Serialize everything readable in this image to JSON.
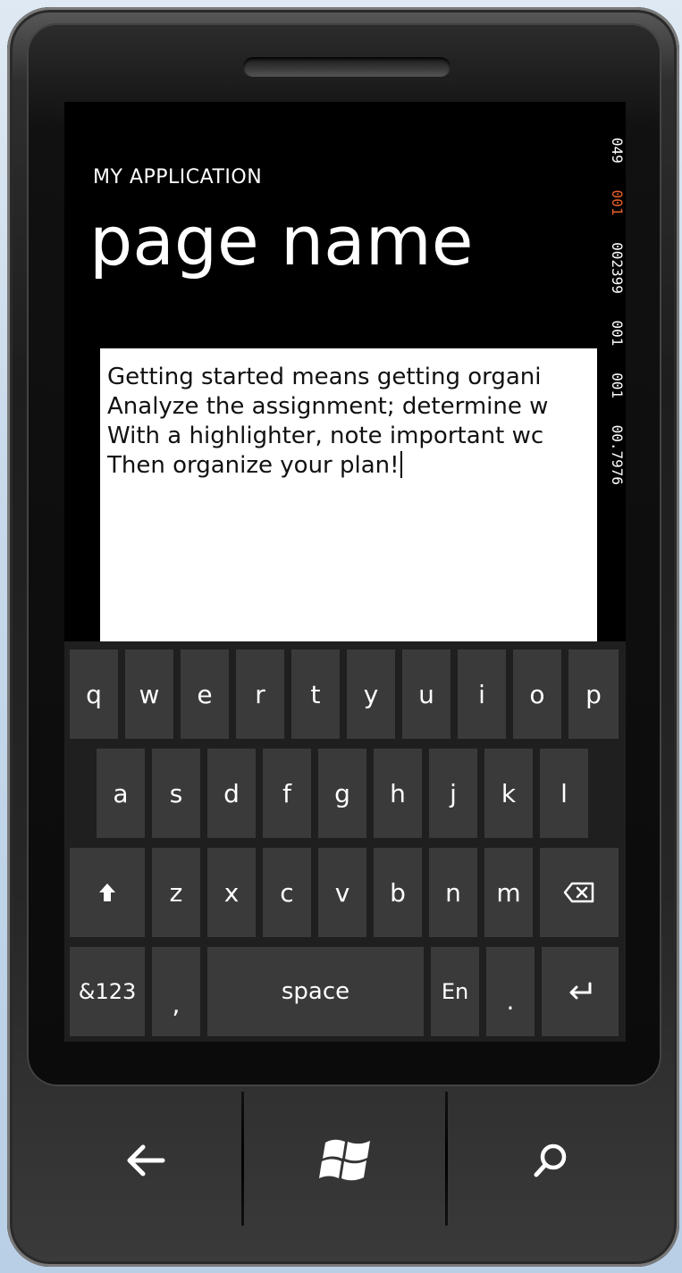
{
  "app": {
    "title": "MY APPLICATION",
    "page_title": "page name"
  },
  "counters": [
    "049",
    "001",
    "002399",
    "001",
    "001",
    "00.7976"
  ],
  "textbox": {
    "lines": [
      "Getting started means getting organi",
      "Analyze the assignment; determine w",
      "With a highlighter, note important wc",
      "Then organize your plan!"
    ]
  },
  "keyboard": {
    "row1": [
      "q",
      "w",
      "e",
      "r",
      "t",
      "y",
      "u",
      "i",
      "o",
      "p"
    ],
    "row2": [
      "a",
      "s",
      "d",
      "f",
      "g",
      "h",
      "j",
      "k",
      "l"
    ],
    "row3": [
      "z",
      "x",
      "c",
      "v",
      "b",
      "n",
      "m"
    ],
    "row4": {
      "symbols": "&123",
      "comma": ",",
      "space": "space",
      "language": "En",
      "period": "."
    }
  },
  "hardware": [
    "back-icon",
    "windows-start-icon",
    "search-icon"
  ],
  "colors": {
    "screen_bg": "#000000",
    "key_bg": "#3a3a3a",
    "keyboard_bg": "#1f1f1f",
    "counter_highlight": "#e8602a"
  }
}
